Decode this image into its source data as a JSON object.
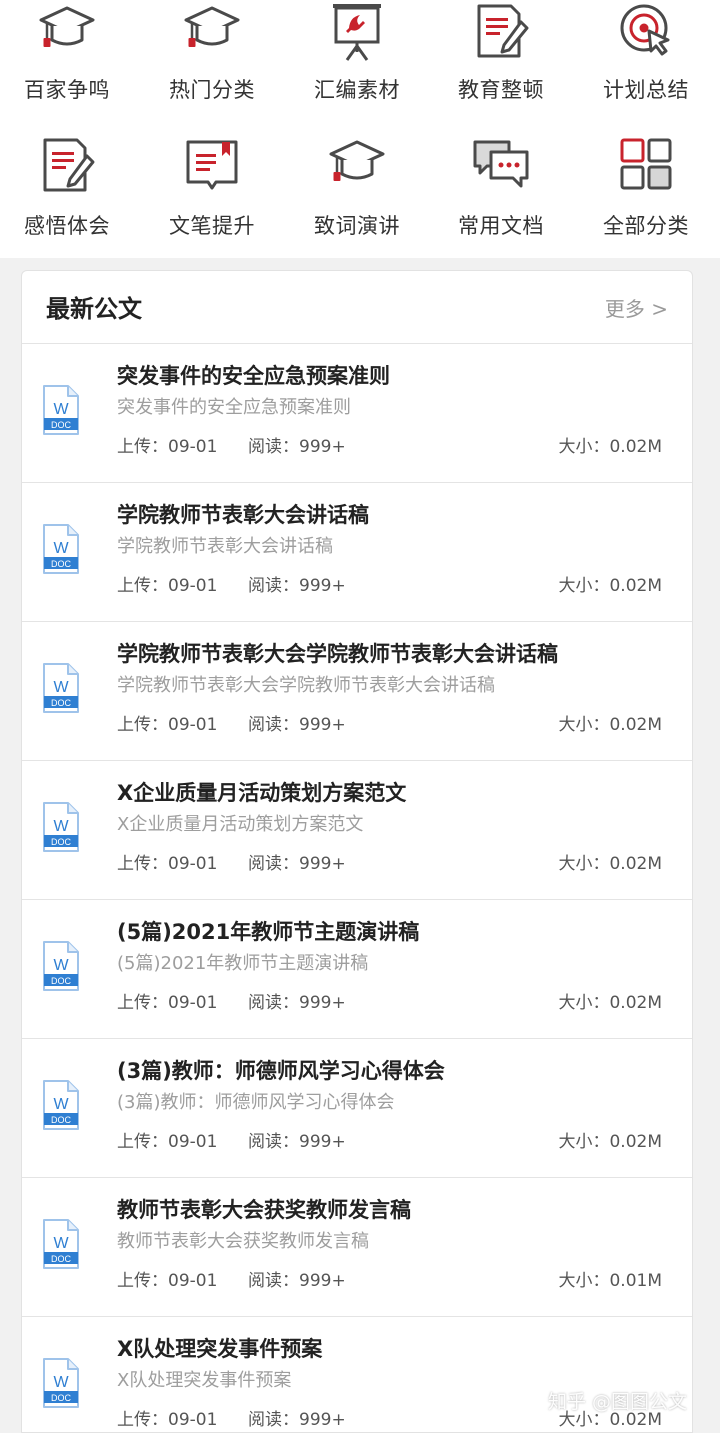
{
  "colors": {
    "accent_red": "#c8232c",
    "icon_gray": "#4a4a4a",
    "doc_blue": "#2f7fd2"
  },
  "categories": [
    {
      "label": "百家争鸣",
      "icon": "graduation-cap-icon"
    },
    {
      "label": "热门分类",
      "icon": "graduation-cap-icon"
    },
    {
      "label": "汇编素材",
      "icon": "presentation-board-icon"
    },
    {
      "label": "教育整顿",
      "icon": "document-pen-icon"
    },
    {
      "label": "计划总结",
      "icon": "target-cursor-icon"
    },
    {
      "label": "感悟体会",
      "icon": "document-pen-icon"
    },
    {
      "label": "文笔提升",
      "icon": "open-book-icon"
    },
    {
      "label": "致词演讲",
      "icon": "graduation-cap-icon"
    },
    {
      "label": "常用文档",
      "icon": "chat-bubbles-icon"
    },
    {
      "label": "全部分类",
      "icon": "grid-icon"
    }
  ],
  "latest": {
    "title": "最新公文",
    "more_label": "更多 >"
  },
  "doc_icon": {
    "letter": "W",
    "tag": "DOC"
  },
  "docs": [
    {
      "title": "突发事件的安全应急预案准则",
      "subtitle": "突发事件的安全应急预案准则",
      "upload": "上传：09-01",
      "reads": "阅读：999+",
      "size": "大小：0.02M"
    },
    {
      "title": "学院教师节表彰大会讲话稿",
      "subtitle": "学院教师节表彰大会讲话稿",
      "upload": "上传：09-01",
      "reads": "阅读：999+",
      "size": "大小：0.02M"
    },
    {
      "title": "学院教师节表彰大会学院教师节表彰大会讲话稿",
      "subtitle": "学院教师节表彰大会学院教师节表彰大会讲话稿",
      "upload": "上传：09-01",
      "reads": "阅读：999+",
      "size": "大小：0.02M"
    },
    {
      "title": "X企业质量月活动策划方案范文",
      "subtitle": "X企业质量月活动策划方案范文",
      "upload": "上传：09-01",
      "reads": "阅读：999+",
      "size": "大小：0.02M"
    },
    {
      "title": "(5篇)2021年教师节主题演讲稿",
      "subtitle": "(5篇)2021年教师节主题演讲稿",
      "upload": "上传：09-01",
      "reads": "阅读：999+",
      "size": "大小：0.02M"
    },
    {
      "title": "(3篇)教师：师德师风学习心得体会",
      "subtitle": "(3篇)教师：师德师风学习心得体会",
      "upload": "上传：09-01",
      "reads": "阅读：999+",
      "size": "大小：0.02M"
    },
    {
      "title": "教师节表彰大会获奖教师发言稿",
      "subtitle": "教师节表彰大会获奖教师发言稿",
      "upload": "上传：09-01",
      "reads": "阅读：999+",
      "size": "大小：0.01M"
    },
    {
      "title": "X队处理突发事件预案",
      "subtitle": "X队处理突发事件预案",
      "upload": "上传：09-01",
      "reads": "阅读：999+",
      "size": "大小：0.02M"
    }
  ],
  "watermark": "知乎 @图图公文"
}
